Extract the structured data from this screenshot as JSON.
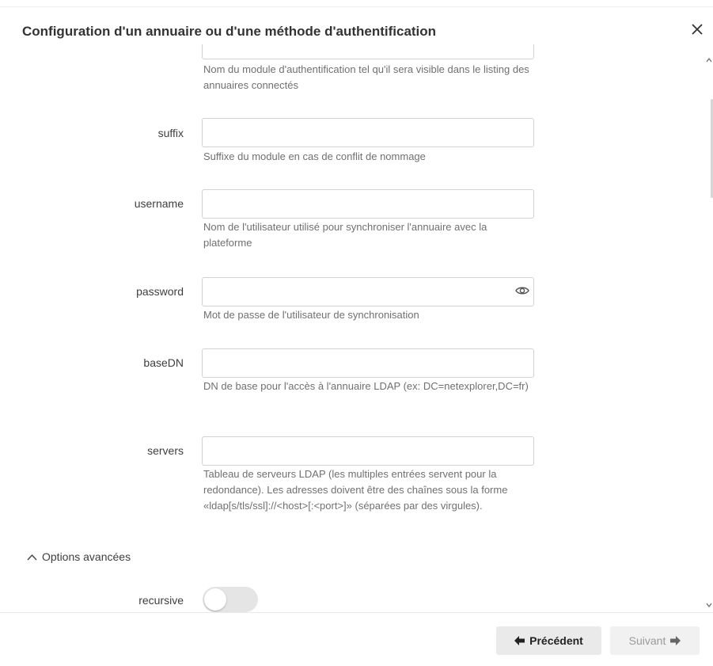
{
  "dialog": {
    "title": "Configuration d'un annuaire ou d'une méthode d'authentification",
    "close_icon": "close-icon"
  },
  "fields": {
    "name": {
      "help": "Nom du module d'authentification tel qu'il sera visible dans le listing des annuaires connectés"
    },
    "suffix": {
      "label": "suffix",
      "value": "",
      "help": "Suffixe du module en cas de conflit de nommage"
    },
    "username": {
      "label": "username",
      "value": "",
      "help": "Nom de l'utilisateur utilisé pour synchroniser l'annuaire avec la plateforme"
    },
    "password": {
      "label": "password",
      "value": "",
      "help": "Mot de passe de l'utilisateur de synchronisation",
      "toggle_icon": "eye-icon"
    },
    "baseDN": {
      "label": "baseDN",
      "value": "",
      "help": "DN de base pour l'accès à l'annuaire LDAP (ex: DC=netexplorer,DC=fr)"
    },
    "servers": {
      "label": "servers",
      "value": "",
      "help": "Tableau de serveurs LDAP (les multiples entrées servent pour la redondance). Les adresses doivent être des chaînes sous la forme «ldap[s/tls/ssl]://<host>[:<port>]» (séparées par des virgules)."
    }
  },
  "advanced": {
    "toggle_label": "Options avancées",
    "icon": "chevron-up-icon",
    "recursive": {
      "label": "recursive",
      "enabled": false
    }
  },
  "footer": {
    "prev_label": "Précédent",
    "prev_icon": "arrow-left-icon",
    "next_label": "Suivant",
    "next_icon": "arrow-right-icon"
  },
  "colors": {
    "input_border": "#d2d2d2",
    "help_text": "#707070",
    "button_bg": "#eaeaea",
    "toggle_off": "#e5e5e5"
  }
}
